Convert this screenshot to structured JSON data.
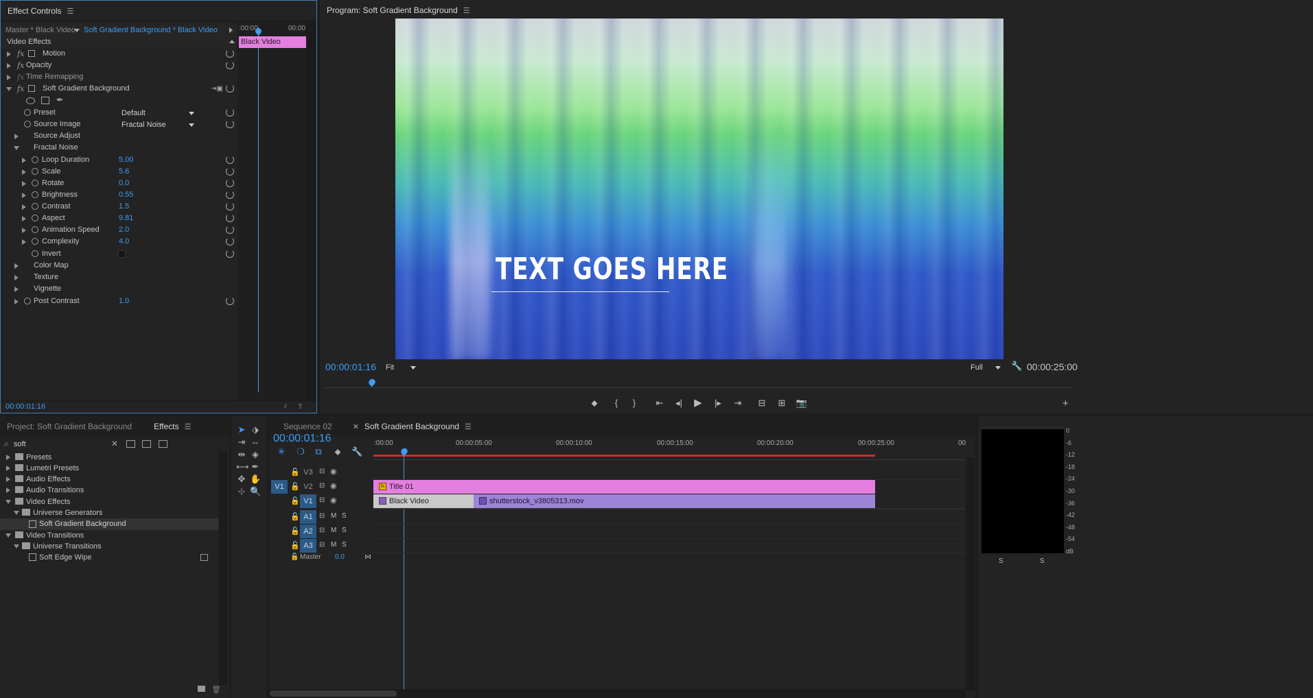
{
  "effect_controls": {
    "tab_title": "Effect Controls",
    "master_label": "Master * Black Video",
    "clip_label": "Soft Gradient Background * Black Video",
    "timecode_start": ":00:00",
    "timecode_end": "00:00",
    "clip_bar_label": "Black Video",
    "section": "Video Effects",
    "motion": "Motion",
    "opacity": "Opacity",
    "time_remapping": "Time Remapping",
    "effect_name": "Soft Gradient Background",
    "preset_label": "Preset",
    "preset_value": "Default",
    "source_image_label": "Source Image",
    "source_image_value": "Fractal Noise",
    "source_adjust": "Source Adjust",
    "fractal_noise": "Fractal Noise",
    "params": [
      {
        "label": "Loop Duration",
        "value": "5.00"
      },
      {
        "label": "Scale",
        "value": "5.6"
      },
      {
        "label": "Rotate",
        "value": "0.0"
      },
      {
        "label": "Brightness",
        "value": "0.55"
      },
      {
        "label": "Contrast",
        "value": "1.5"
      },
      {
        "label": "Aspect",
        "value": "9.81"
      },
      {
        "label": "Animation Speed",
        "value": "2.0"
      },
      {
        "label": "Complexity",
        "value": "4.0"
      }
    ],
    "invert": "Invert",
    "color_map": "Color Map",
    "texture": "Texture",
    "vignette": "Vignette",
    "post_contrast_label": "Post Contrast",
    "post_contrast_value": "1.0",
    "footer_timecode": "00:00:01:16"
  },
  "program": {
    "tab_title": "Program: Soft Gradient Background",
    "overlay_text": "TEXT GOES HERE",
    "timecode": "00:00:01:16",
    "fit": "Fit",
    "quality": "Full",
    "duration": "00:00:25:00",
    "playhead_fraction": 0.064
  },
  "project": {
    "tab_project": "Project: Soft Gradient Background",
    "tab_effects": "Effects",
    "search_value": "soft",
    "tree": [
      {
        "label": "Presets",
        "level": 0,
        "type": "folder-closed"
      },
      {
        "label": "Lumetri Presets",
        "level": 0,
        "type": "folder-closed"
      },
      {
        "label": "Audio Effects",
        "level": 0,
        "type": "folder-closed"
      },
      {
        "label": "Audio Transitions",
        "level": 0,
        "type": "folder-closed"
      },
      {
        "label": "Video Effects",
        "level": 0,
        "type": "folder-open"
      },
      {
        "label": "Universe Generators",
        "level": 1,
        "type": "folder-open"
      },
      {
        "label": "Soft Gradient Background",
        "level": 2,
        "type": "effect"
      },
      {
        "label": "Video Transitions",
        "level": 0,
        "type": "folder-open"
      },
      {
        "label": "Universe Transitions",
        "level": 1,
        "type": "folder-open"
      },
      {
        "label": "Soft Edge Wipe",
        "level": 2,
        "type": "effect"
      }
    ]
  },
  "timeline": {
    "tab_seq02": "Sequence 02",
    "tab_active": "Soft Gradient Background",
    "timecode": "00:00:01:16",
    "ruler": [
      ":00:00",
      "00:00:05:00",
      "00:00:10:00",
      "00:00:15:00",
      "00:00:20:00",
      "00:00:25:00",
      "00"
    ],
    "tracks": {
      "v3": "V3",
      "v2": "V2",
      "v1": "V1",
      "a1": "A1",
      "a2": "A2",
      "a3": "A3",
      "src_v1": "V1",
      "master": "Master",
      "master_value": "0.0",
      "m": "M",
      "s": "S"
    },
    "clips": {
      "title": "Title 01",
      "black_video": "Black Video",
      "mov": "shutterstock_v3805313.mov"
    }
  },
  "meter": {
    "scale": [
      "0",
      "-6",
      "-12",
      "-18",
      "-24",
      "-30",
      "-36",
      "-42",
      "-48",
      "-54",
      "dB"
    ],
    "solo_left": "S",
    "solo_right": "S"
  }
}
